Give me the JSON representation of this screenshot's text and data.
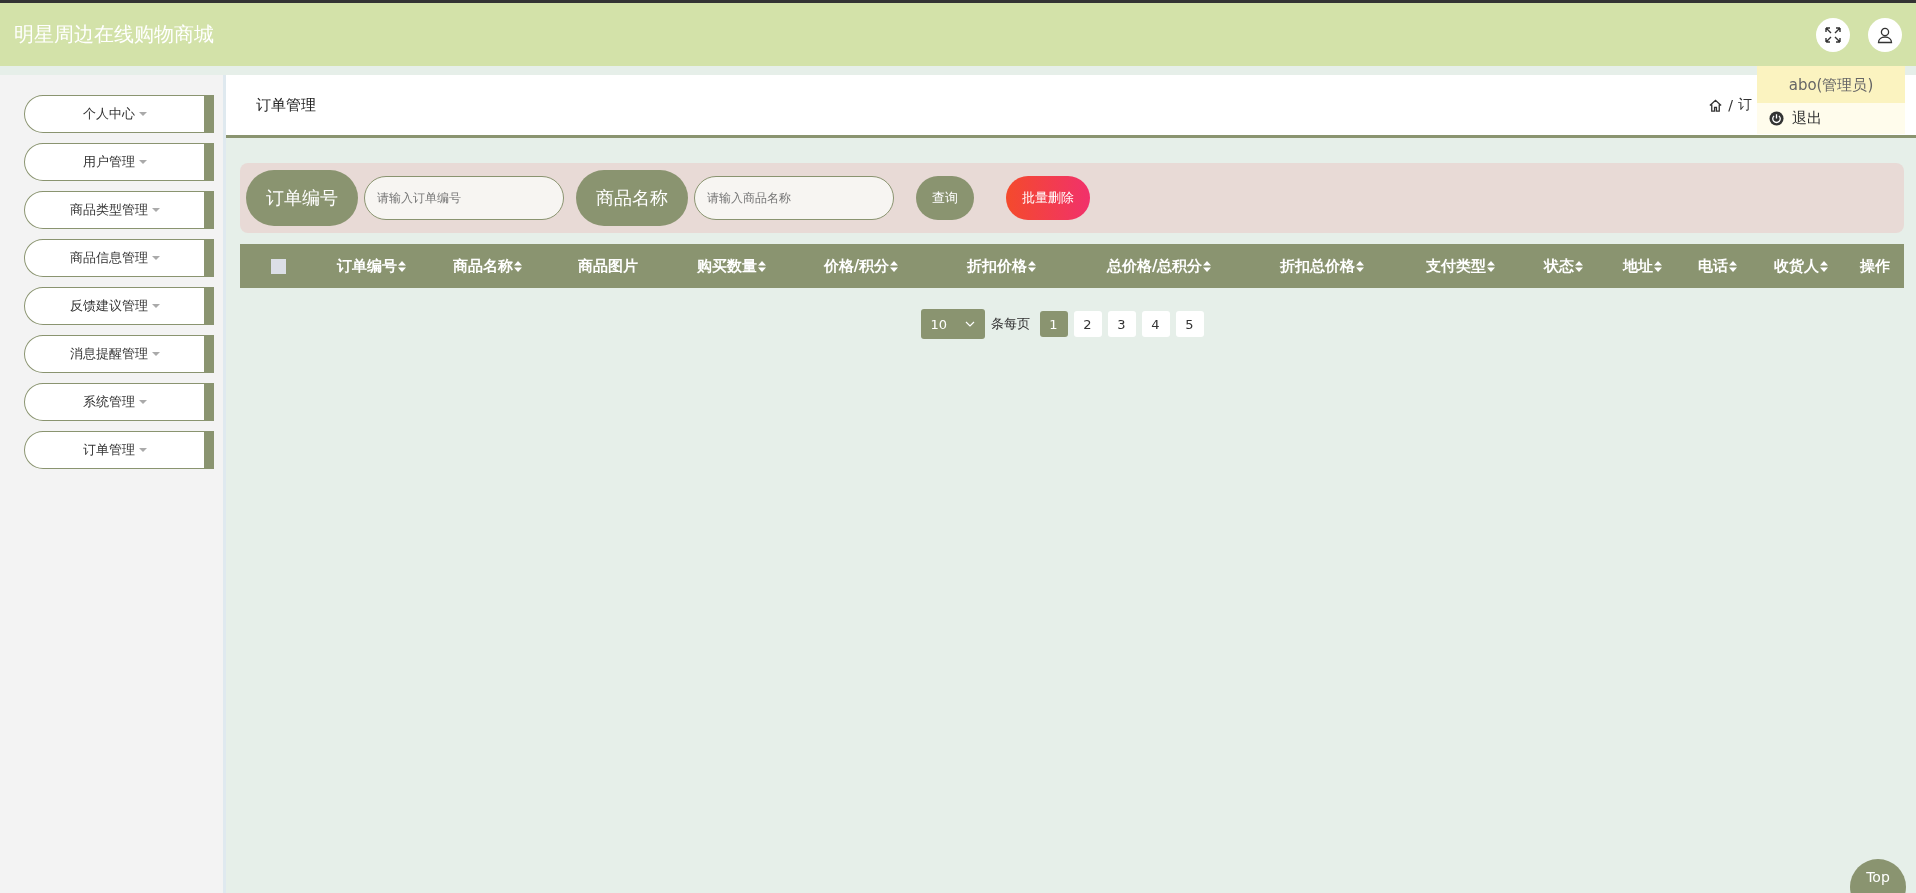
{
  "header": {
    "title": "明星周边在线购物商城"
  },
  "sidebar": {
    "items": [
      {
        "label": "个人中心"
      },
      {
        "label": "用户管理"
      },
      {
        "label": "商品类型管理"
      },
      {
        "label": "商品信息管理"
      },
      {
        "label": "反馈建议管理"
      },
      {
        "label": "消息提醒管理"
      },
      {
        "label": "系统管理"
      },
      {
        "label": "订单管理"
      }
    ]
  },
  "page_title": "订单管理",
  "breadcrumb": [
    {
      "separator": "/",
      "label": "订"
    }
  ],
  "user_menu": {
    "user": "abo(管理员)",
    "logout": "退出"
  },
  "search": {
    "fields": [
      {
        "label": "订单编号",
        "placeholder": "请输入订单编号"
      },
      {
        "label": "商品名称",
        "placeholder": "请输入商品名称"
      }
    ],
    "buttons": [
      {
        "label": "查询",
        "kind": "primary"
      },
      {
        "label": "批量删除",
        "kind": "danger"
      }
    ]
  },
  "table": {
    "select_all_checked": false,
    "columns": [
      {
        "label": "订单编号",
        "sortable": true
      },
      {
        "label": "商品名称",
        "sortable": true
      },
      {
        "label": "商品图片",
        "sortable": false
      },
      {
        "label": "购买数量",
        "sortable": true
      },
      {
        "label": "价格/积分",
        "sortable": true
      },
      {
        "label": "折扣价格",
        "sortable": true
      },
      {
        "label": "总价格/总积分",
        "sortable": true
      },
      {
        "label": "折扣总价格",
        "sortable": true
      },
      {
        "label": "支付类型",
        "sortable": true
      },
      {
        "label": "状态",
        "sortable": true
      },
      {
        "label": "地址",
        "sortable": true
      },
      {
        "label": "电话",
        "sortable": true
      },
      {
        "label": "收货人",
        "sortable": true
      },
      {
        "label": "操作",
        "sortable": false
      }
    ]
  },
  "pagination": {
    "page_size": "10",
    "page_size_label": "条每页",
    "pages": [
      {
        "label": "1",
        "selected": true
      },
      {
        "label": "2",
        "selected": false
      },
      {
        "label": "3",
        "selected": false
      },
      {
        "label": "4",
        "selected": false
      },
      {
        "label": "5",
        "selected": false
      }
    ]
  },
  "back_to_top": "Top"
}
